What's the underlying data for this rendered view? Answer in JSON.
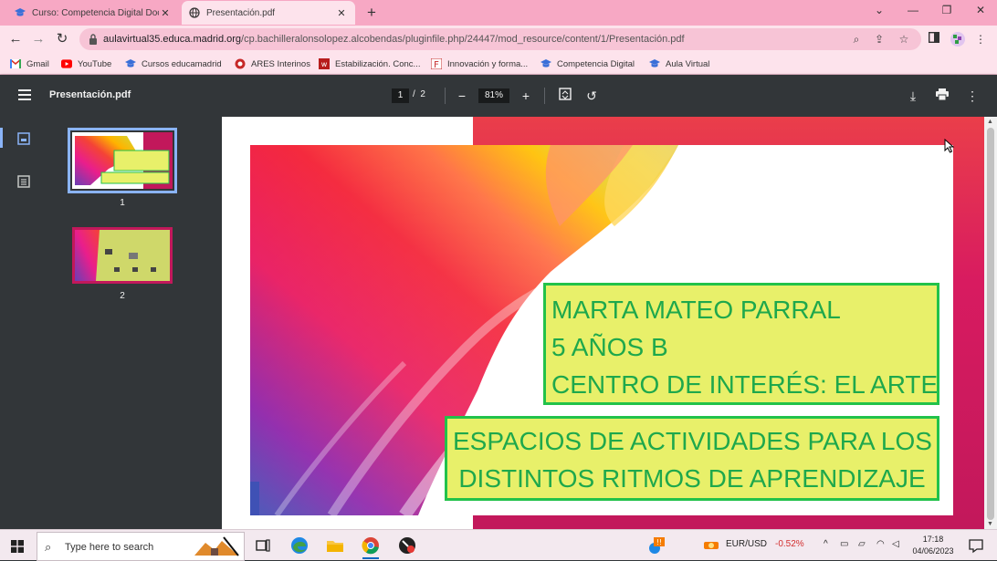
{
  "browser": {
    "tabs": [
      {
        "title": "Curso: Competencia Digital Doce",
        "active": false
      },
      {
        "title": "Presentación.pdf",
        "active": true
      }
    ],
    "url_host": "aulavirtual35.educa.madrid.org",
    "url_path": "/cp.bachilleralonsolopez.alcobendas/pluginfile.php/24447/mod_resource/content/1/Presentación.pdf",
    "bookmarks": [
      {
        "label": "Gmail",
        "icon": "gmail-icon"
      },
      {
        "label": "YouTube",
        "icon": "youtube-icon"
      },
      {
        "label": "Cursos educamadrid",
        "icon": "graduation-cap-icon"
      },
      {
        "label": "ARES Interinos",
        "icon": "ares-icon"
      },
      {
        "label": "Estabilización. Conc...",
        "icon": "bookmark-site-icon"
      },
      {
        "label": "Innovación y forma...",
        "icon": "bookmark-site-icon"
      },
      {
        "label": "Competencia Digital",
        "icon": "graduation-cap-icon"
      },
      {
        "label": "Aula Virtual",
        "icon": "graduation-cap-icon"
      }
    ]
  },
  "pdf": {
    "filename": "Presentación.pdf",
    "current_page": "1",
    "page_sep": "/",
    "total_pages": "2",
    "zoom": "81%",
    "thumbnails": [
      {
        "number": "1",
        "selected": true
      },
      {
        "number": "2",
        "selected": false
      }
    ]
  },
  "slide": {
    "box1_lines": [
      "MARTA MATEO PARRAL",
      "5 AÑOS B",
      "CENTRO DE INTERÉS: EL ARTE"
    ],
    "box2_lines": [
      "ESPACIOS DE ACTIVIDADES PARA LOS",
      "DISTINTOS RITMOS DE APRENDIZAJE"
    ]
  },
  "taskbar": {
    "search_placeholder": "Type here to search",
    "ticker_label": "EUR/USD",
    "ticker_change": "-0.52%",
    "time": "17:18",
    "date": "04/06/2023"
  },
  "colors": {
    "tab_strip": "#f7a8c4",
    "toolbar": "#fde3ec",
    "pdf_chrome": "#323639",
    "box_fill": "#e8f06a",
    "box_border": "#22c24a",
    "box_text": "#1ea84c",
    "ticker_negative": "#d32f2f"
  }
}
